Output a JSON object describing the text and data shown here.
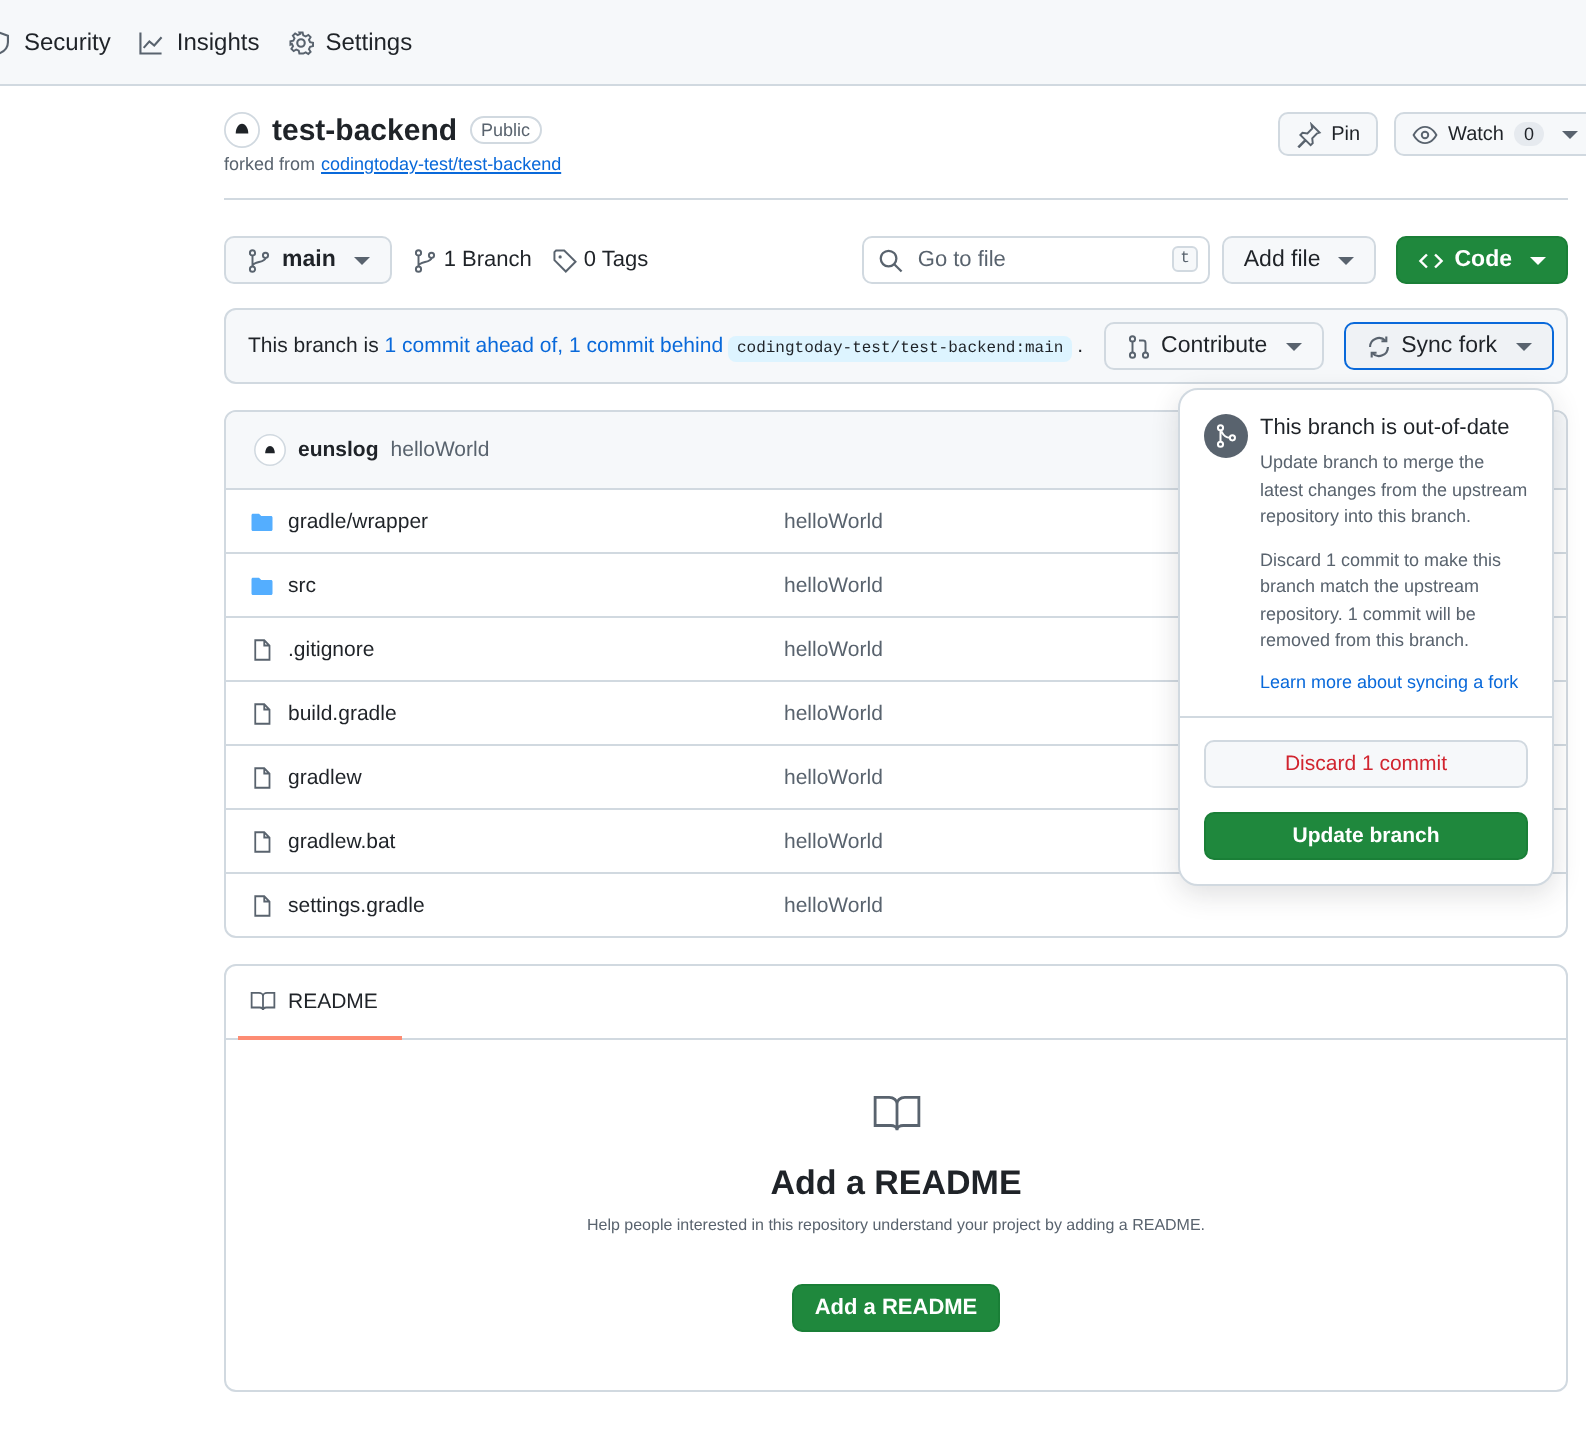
{
  "nav": {
    "tabs": [
      {
        "label": "Security",
        "kind": "shield"
      },
      {
        "label": "Insights",
        "kind": "graph"
      },
      {
        "label": "Settings",
        "kind": "gear"
      }
    ]
  },
  "repo": {
    "name": "test-backend",
    "visibility": "Public",
    "forked_prefix": "forked from",
    "forked_link": "codingtoday-test/test-backend",
    "pin": "Pin",
    "watch": "Watch",
    "watch_count": "0"
  },
  "toolbar": {
    "branch": "main",
    "branches": "1 Branch",
    "tags": "0 Tags",
    "search": {
      "placeholder": "Go to file",
      "shortcut": "t"
    },
    "add_file": "Add file",
    "code": "Code"
  },
  "sync_bar": {
    "prefix": "This branch is",
    "ahead": "1 commit ahead of,",
    "behind": "1 commit behind",
    "ref": "codingtoday-test/test-backend:main",
    "suffix": ".",
    "contribute": "Contribute",
    "sync_fork": "Sync fork",
    "sync_expanded": true
  },
  "latest_commit": {
    "author": "eunslog",
    "message": "helloWorld"
  },
  "files": [
    {
      "name": "gradle/wrapper",
      "kind": "folder",
      "commit": "helloWorld"
    },
    {
      "name": "src",
      "kind": "folder",
      "commit": "helloWorld"
    },
    {
      "name": ".gitignore",
      "kind": "file",
      "commit": "helloWorld"
    },
    {
      "name": "build.gradle",
      "kind": "file",
      "commit": "helloWorld"
    },
    {
      "name": "gradlew",
      "kind": "file",
      "commit": "helloWorld"
    },
    {
      "name": "gradlew.bat",
      "kind": "file",
      "commit": "helloWorld"
    },
    {
      "name": "settings.gradle",
      "kind": "file",
      "commit": "helloWorld"
    }
  ],
  "popover": {
    "title": "This branch is out-of-date",
    "paragraphs": [
      "Update branch to merge the latest changes from the upstream repository into this branch.",
      "Discard 1 commit to make this branch match the upstream repository. 1 commit will be removed from this branch."
    ],
    "link": "Learn more about syncing a fork",
    "discard": "Discard 1 commit",
    "update": "Update branch"
  },
  "readme": {
    "tab": "README",
    "heading": "Add a README",
    "text": "Help people interested in this repository understand your project by adding a README.",
    "button": "Add a README"
  }
}
